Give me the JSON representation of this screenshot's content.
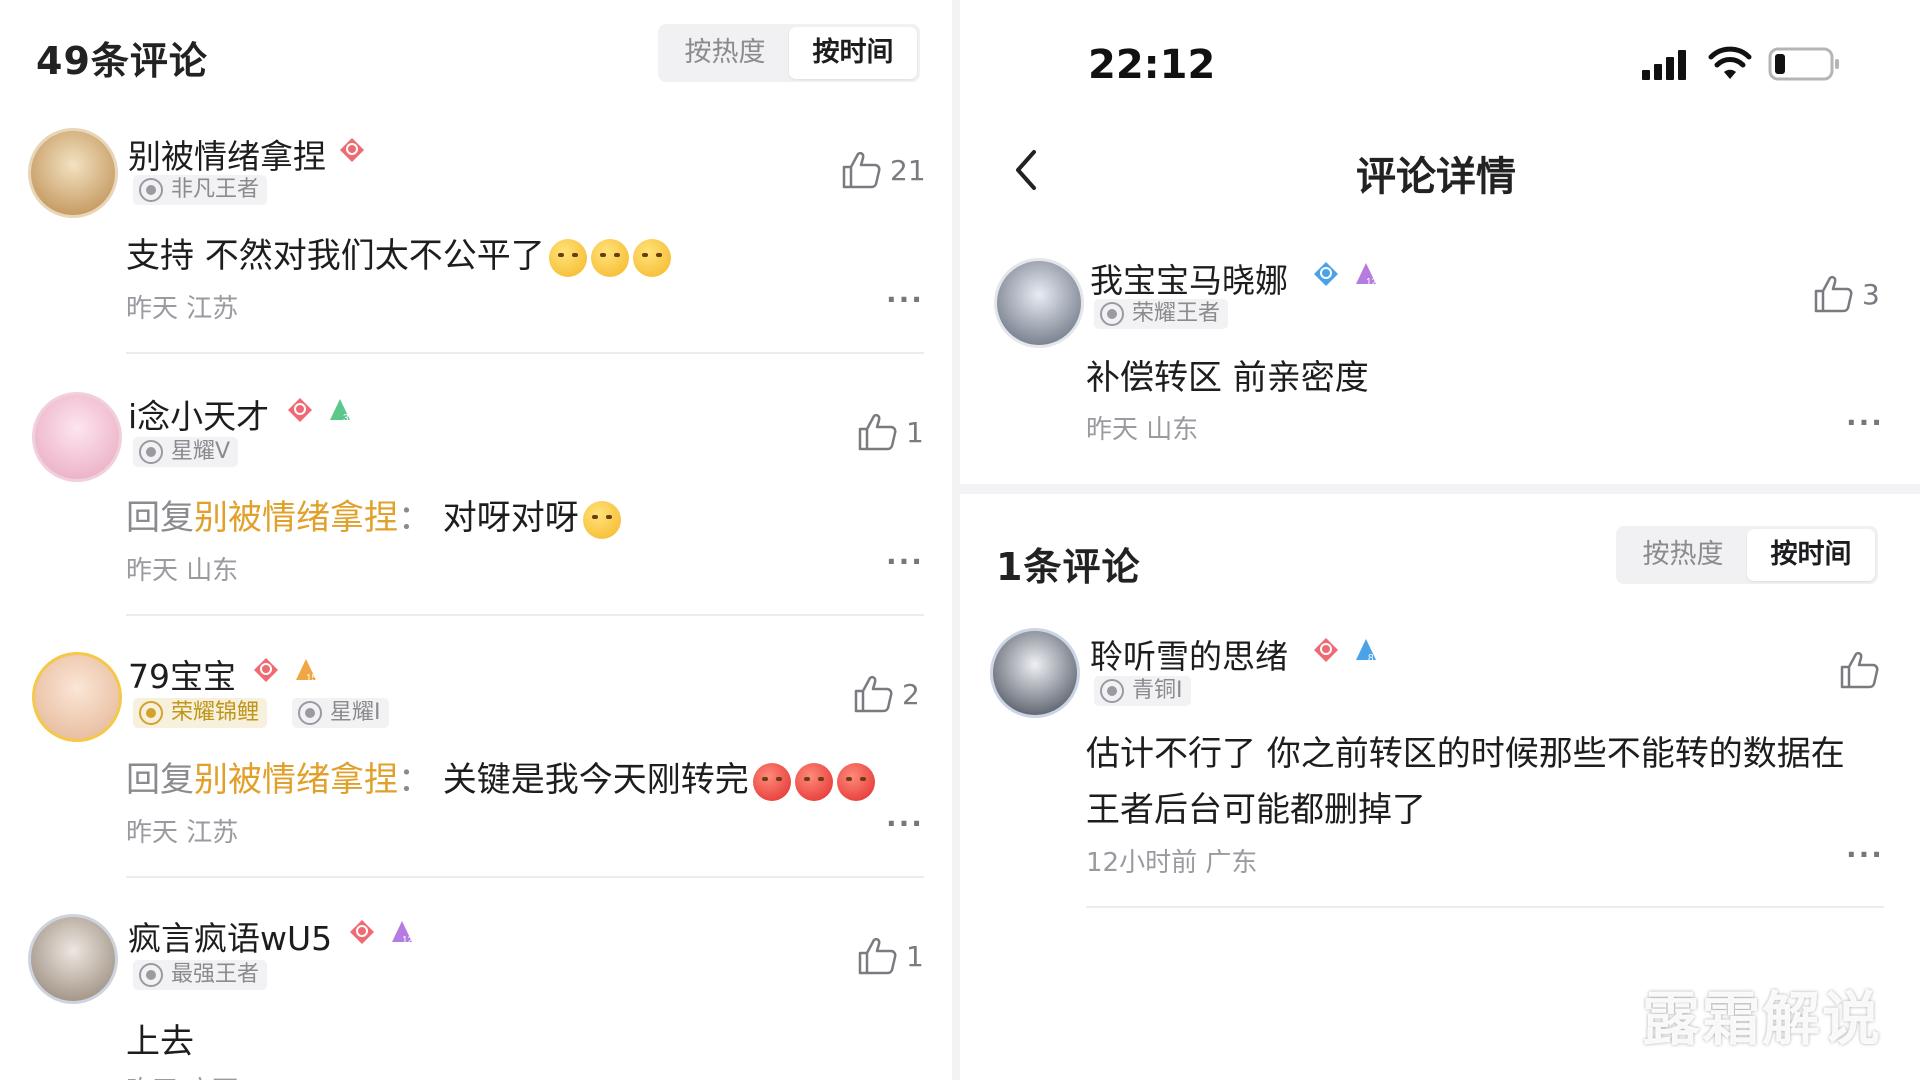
{
  "left": {
    "count_title": "49条评论",
    "sort": [
      "按热度",
      "按时间"
    ],
    "comments": [
      {
        "user": "别被情绪拿捏",
        "rank": "非凡王者",
        "text": "支持 不然对我们太不公平了",
        "meta": "昨天 江苏",
        "likes": "21"
      },
      {
        "user": "i念小天才",
        "rank": "星耀V",
        "reply_prefix": "回复",
        "reply_to": "别被情绪拿捏",
        "reply_sep": "：",
        "text": " 对呀对呀",
        "meta": "昨天 山东",
        "likes": "1"
      },
      {
        "user": "79宝宝",
        "rank_gold": "荣耀锦鲤",
        "rank": "星耀I",
        "reply_prefix": "回复",
        "reply_to": "别被情绪拿捏",
        "reply_sep": "：",
        "text": " 关键是我今天刚转完",
        "meta": "昨天 江苏",
        "likes": "2"
      },
      {
        "user": "疯言疯语wU5",
        "rank": "最强王者",
        "text": "上去",
        "meta": "昨天 广西",
        "likes": "1"
      }
    ]
  },
  "right": {
    "status_time": "22:12",
    "nav_title": "评论详情",
    "main_comment": {
      "user": "我宝宝马晓娜",
      "rank": "荣耀王者",
      "text": "补偿转区  前亲密度",
      "meta": "昨天 山东",
      "likes": "3"
    },
    "count_title": "1条评论",
    "sort": [
      "按热度",
      "按时间"
    ],
    "reply": {
      "user": "聆听雪的思绪",
      "rank": "青铜I",
      "text_line1": "估计不行了 你之前转区的时候那些不能转的数据在",
      "text_line2": "王者后台可能都删掉了",
      "meta": "12小时前 广东"
    },
    "more": "···"
  },
  "watermark": "露霜解说",
  "colors": {
    "accent_reply": "#e0a02a",
    "muted": "#9a9aa0",
    "divider": "#ececee"
  }
}
